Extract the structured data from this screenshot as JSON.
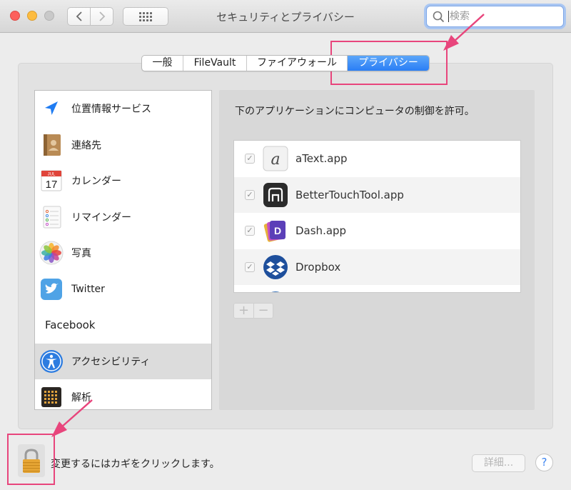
{
  "window": {
    "title": "セキュリティとプライバシー",
    "search_placeholder": "検索"
  },
  "tabs": [
    {
      "label": "一般",
      "active": false
    },
    {
      "label": "FileVault",
      "active": false
    },
    {
      "label": "ファイアウォール",
      "active": false
    },
    {
      "label": "プライバシー",
      "active": true
    }
  ],
  "sidebar": {
    "items": [
      {
        "label": "位置情報サービス",
        "icon": "location-arrow-icon"
      },
      {
        "label": "連絡先",
        "icon": "contacts-book-icon"
      },
      {
        "label": "カレンダー",
        "icon": "calendar-icon",
        "icon_month": "JUL",
        "icon_day": "17"
      },
      {
        "label": "リマインダー",
        "icon": "reminders-icon"
      },
      {
        "label": "写真",
        "icon": "photos-icon"
      },
      {
        "label": "Twitter",
        "icon": "twitter-icon"
      },
      {
        "label": "Facebook",
        "icon": ""
      },
      {
        "label": "アクセシビリティ",
        "icon": "accessibility-icon",
        "selected": true
      },
      {
        "label": "解析",
        "icon": "analytics-icon"
      }
    ]
  },
  "main": {
    "description": "下のアプリケーションにコンピュータの制御を許可。",
    "apps": [
      {
        "name": "aText.app",
        "checked": true,
        "icon": "atext-icon"
      },
      {
        "name": "BetterTouchTool.app",
        "checked": true,
        "icon": "bettertouchtool-icon"
      },
      {
        "name": "Dash.app",
        "checked": true,
        "icon": "dash-icon"
      },
      {
        "name": "Dropbox",
        "checked": true,
        "icon": "dropbox-icon"
      }
    ],
    "add_label": "+",
    "remove_label": "−"
  },
  "footer": {
    "lock_text": "変更するにはカギをクリックします。",
    "details_label": "詳細...",
    "help_label": "?"
  },
  "colors": {
    "accent": "#2a7ef5",
    "annotation": "#e8457c"
  }
}
